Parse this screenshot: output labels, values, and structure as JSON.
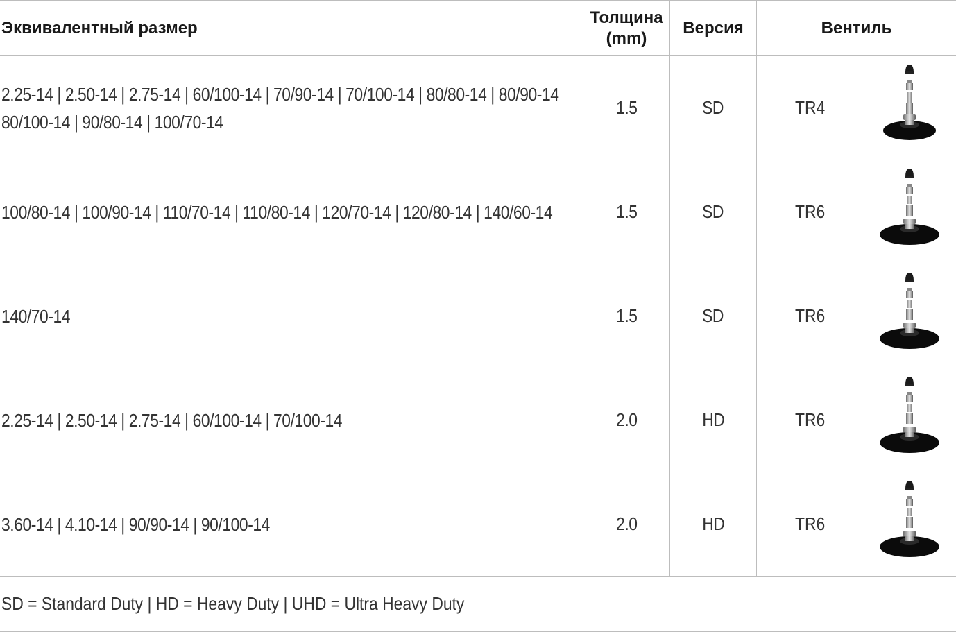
{
  "header": {
    "size": "Эквивалентный размер",
    "thickness_line1": "Толщина",
    "thickness_line2": "(mm)",
    "version": "Версия",
    "valve": "Вентиль"
  },
  "rows": [
    {
      "sizes_line1": "2.25-14 | 2.50-14 | 2.75-14 | 60/100-14 | 70/90-14 | 70/100-14 | 80/80-14 | 80/90-14",
      "sizes_line2": "80/100-14 | 90/80-14 | 100/70-14",
      "thickness": "1.5",
      "version": "SD",
      "valve": "TR4",
      "valve_icon": "valve-tr4-icon"
    },
    {
      "sizes_line1": "100/80-14 | 100/90-14 | 110/70-14 | 110/80-14 | 120/70-14 | 120/80-14 | 140/60-14",
      "sizes_line2": "",
      "thickness": "1.5",
      "version": "SD",
      "valve": "TR6",
      "valve_icon": "valve-tr6-icon"
    },
    {
      "sizes_line1": "140/70-14",
      "sizes_line2": "",
      "thickness": "1.5",
      "version": "SD",
      "valve": "TR6",
      "valve_icon": "valve-tr6-icon"
    },
    {
      "sizes_line1": "2.25-14 | 2.50-14 | 2.75-14 | 60/100-14 | 70/100-14",
      "sizes_line2": "",
      "thickness": "2.0",
      "version": "HD",
      "valve": "TR6",
      "valve_icon": "valve-tr6-icon"
    },
    {
      "sizes_line1": "3.60-14 | 4.10-14 | 90/90-14 | 90/100-14",
      "sizes_line2": "",
      "thickness": "2.0",
      "version": "HD",
      "valve": "TR6",
      "valve_icon": "valve-tr6-icon"
    }
  ],
  "footer": "SD = Standard Duty | HD = Heavy Duty | UHD = Ultra Heavy Duty"
}
